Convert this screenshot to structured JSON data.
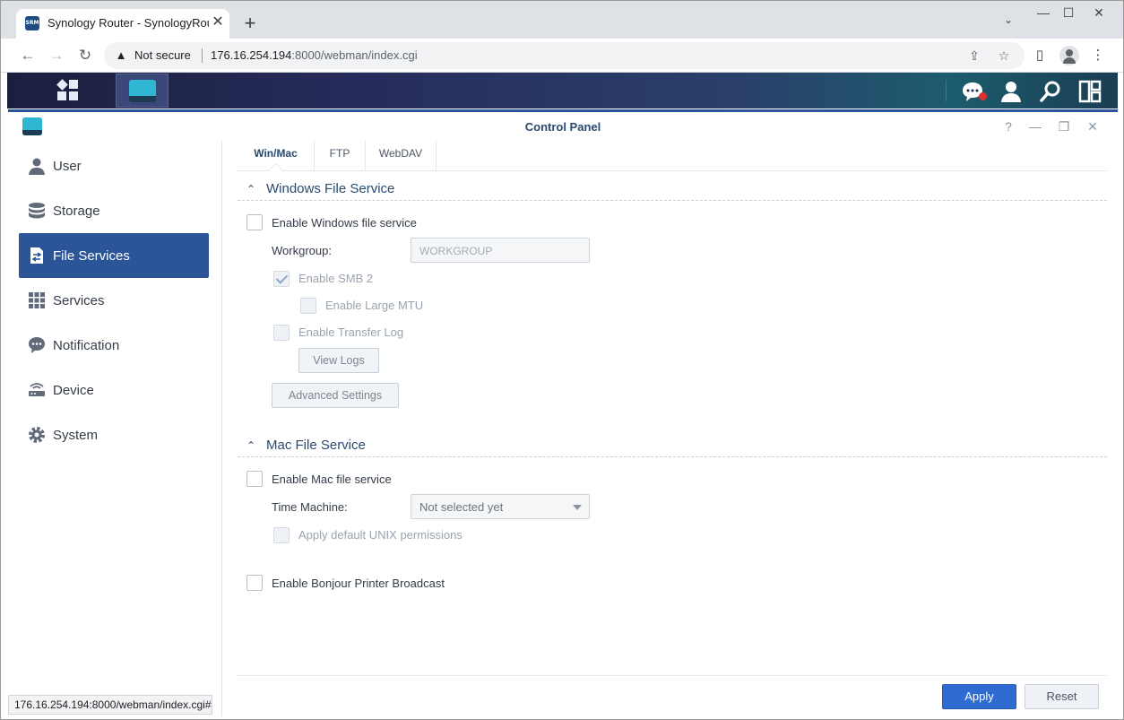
{
  "browser": {
    "tab_title": "Synology Router - SynologyRouter",
    "favicon_text": "SRM",
    "security_label": "Not secure",
    "url_host": "176.16.254.194",
    "url_rest": ":8000/webman/index.cgi",
    "status_url": "176.16.254.194:8000/webman/index.cgi#"
  },
  "window": {
    "title": "Control Panel"
  },
  "sidebar": {
    "items": [
      {
        "label": "User",
        "icon": "user-icon"
      },
      {
        "label": "Storage",
        "icon": "storage-icon"
      },
      {
        "label": "File Services",
        "icon": "file-services-icon"
      },
      {
        "label": "Services",
        "icon": "grid-icon"
      },
      {
        "label": "Notification",
        "icon": "chat-bubble-icon"
      },
      {
        "label": "Device",
        "icon": "router-icon"
      },
      {
        "label": "System",
        "icon": "gear-icon"
      }
    ],
    "active": "File Services"
  },
  "tabs": [
    {
      "label": "Win/Mac"
    },
    {
      "label": "FTP"
    },
    {
      "label": "WebDAV"
    }
  ],
  "windows_section": {
    "title": "Windows File Service",
    "enable_label": "Enable Windows file service",
    "workgroup_label": "Workgroup:",
    "workgroup_value": "WORKGROUP",
    "smb2_label": "Enable SMB 2",
    "large_mtu_label": "Enable Large MTU",
    "transfer_log_label": "Enable Transfer Log",
    "view_logs_label": "View Logs",
    "advanced_label": "Advanced Settings"
  },
  "mac_section": {
    "title": "Mac File Service",
    "enable_label": "Enable Mac file service",
    "time_machine_label": "Time Machine:",
    "time_machine_value": "Not selected yet",
    "unix_label": "Apply default UNIX permissions"
  },
  "bonjour_label": "Enable Bonjour Printer Broadcast",
  "footer": {
    "apply_label": "Apply",
    "reset_label": "Reset"
  },
  "colors": {
    "accent": "#2b5596",
    "apply": "#2f6bd1",
    "title": "#2b4a6f"
  }
}
